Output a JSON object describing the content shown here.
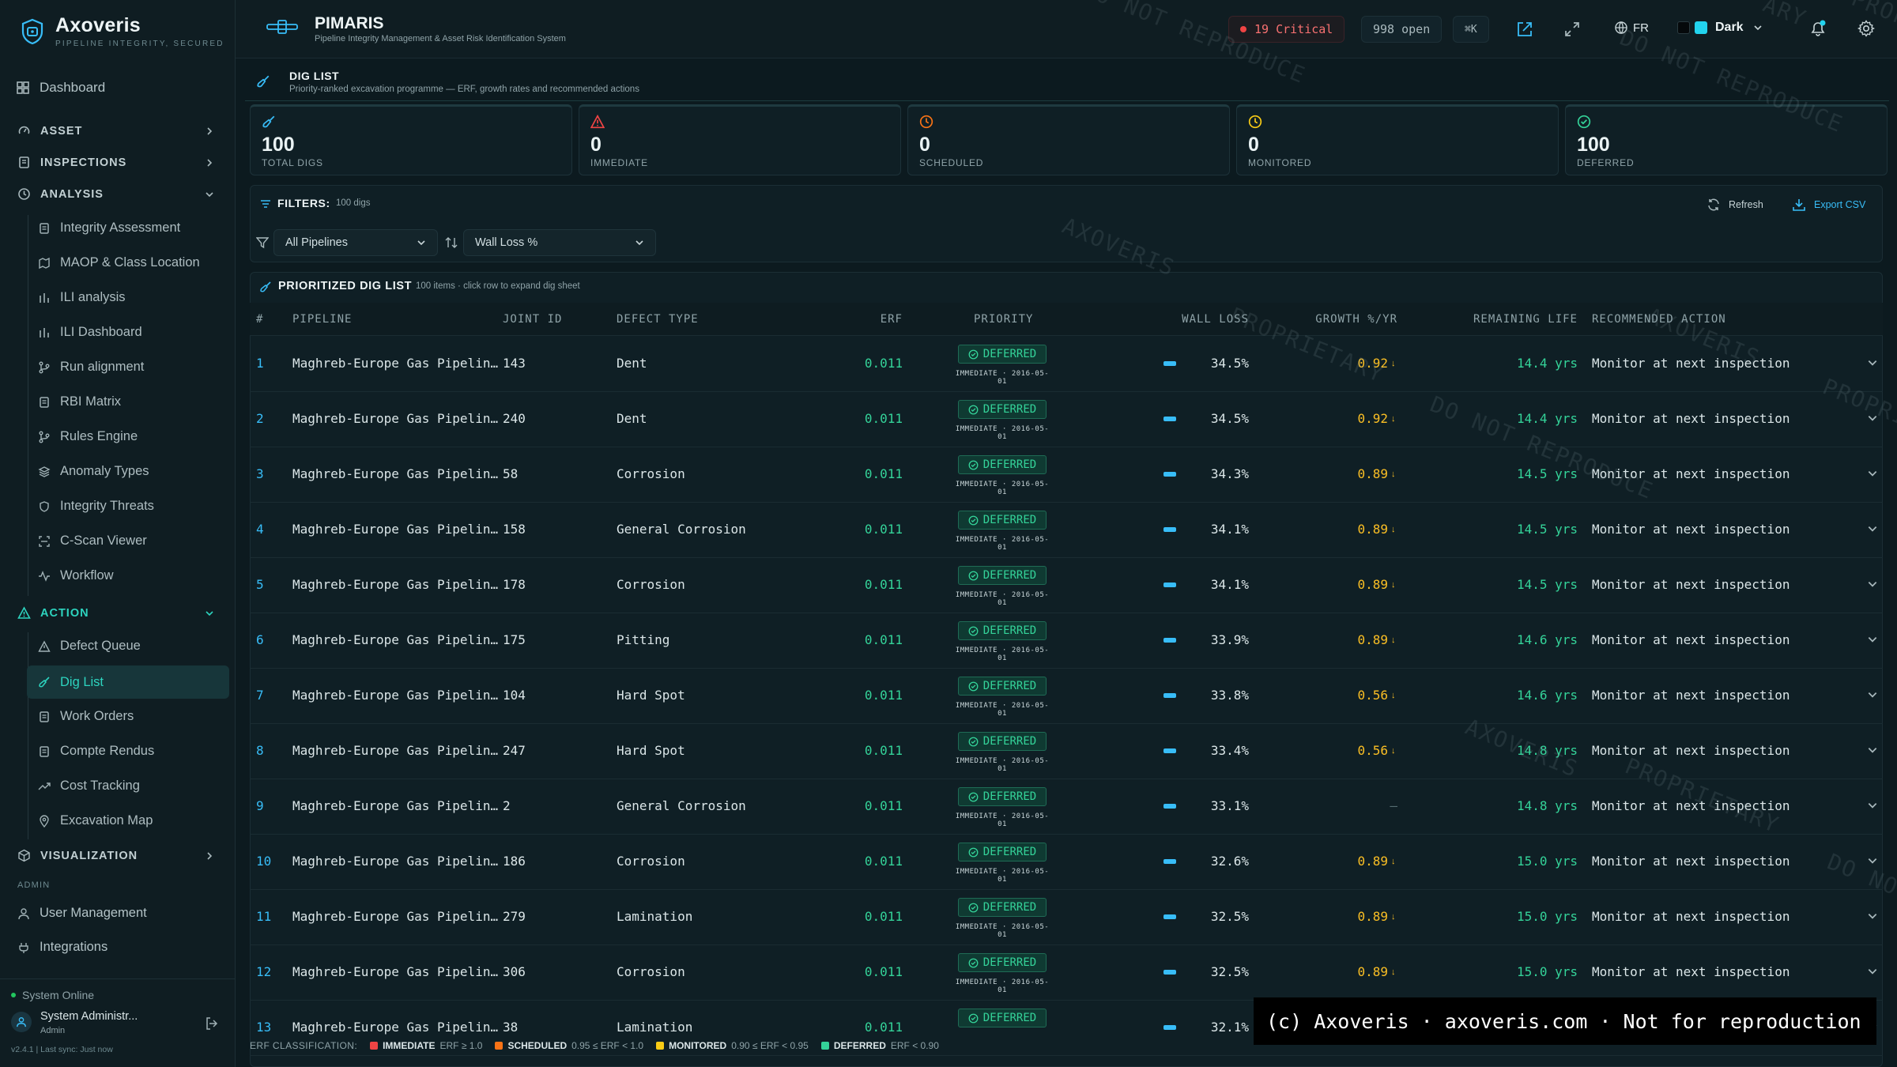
{
  "brand": {
    "name": "Axoveris",
    "tagline": "PIPELINE INTEGRITY, SECURED"
  },
  "sidebar": {
    "dashboard": "Dashboard",
    "sections": {
      "asset": "ASSET",
      "inspections": "INSPECTIONS",
      "analysis": "ANALYSIS",
      "action": "ACTION",
      "visualization": "VISUALIZATION"
    },
    "analysis_items": [
      "Integrity Assessment",
      "MAOP & Class Location",
      "ILI analysis",
      "ILI Dashboard",
      "Run alignment",
      "RBI Matrix",
      "Rules Engine",
      "Anomaly Types",
      "Integrity Threats",
      "C-Scan Viewer",
      "Workflow"
    ],
    "action_items": [
      "Defect Queue",
      "Dig List",
      "Work Orders",
      "Compte Rendus",
      "Cost Tracking",
      "Excavation Map"
    ],
    "admin_label": "ADMIN",
    "admin_items": [
      "User Management",
      "Integrations"
    ],
    "status": "System Online",
    "user_name": "System Administr...",
    "user_role": "Admin",
    "version": "v2.4.1 | Last sync: Just now"
  },
  "topbar": {
    "app_name": "PIMARIS",
    "app_subtitle": "Pipeline Integrity Management & Asset Risk Identification System",
    "critical": "19 Critical",
    "open": "998 open",
    "shortcut": "⌘K",
    "language": "FR",
    "theme": "Dark"
  },
  "page": {
    "title": "DIG LIST",
    "subtitle": "Priority-ranked excavation programme — ERF, growth rates and recommended actions"
  },
  "kpis": [
    {
      "value": "100",
      "label": "TOTAL DIGS",
      "color": "#38bdf8"
    },
    {
      "value": "0",
      "label": "IMMEDIATE",
      "color": "#ef4444"
    },
    {
      "value": "0",
      "label": "SCHEDULED",
      "color": "#f97316"
    },
    {
      "value": "0",
      "label": "MONITORED",
      "color": "#facc15"
    },
    {
      "value": "100",
      "label": "DEFERRED",
      "color": "#34d399"
    }
  ],
  "filters": {
    "label": "FILTERS:",
    "count": "100 digs",
    "refresh": "Refresh",
    "export": "Export CSV",
    "pipeline": "All Pipelines",
    "sort": "Wall Loss %"
  },
  "table": {
    "title": "PRIORITIZED DIG LIST",
    "subtitle": "100 items · click row to expand dig sheet",
    "columns": [
      "#",
      "PIPELINE",
      "JOINT ID",
      "DEFECT TYPE",
      "ERF",
      "PRIORITY",
      "WALL LOSS",
      "GROWTH %/YR",
      "REMAINING LIFE",
      "RECOMMENDED ACTION"
    ],
    "rows": [
      {
        "n": "1",
        "pipeline": "Maghreb-Europe Gas Pipelin…",
        "joint": "143",
        "defect": "Dent",
        "erf": "0.011",
        "priority": "DEFERRED",
        "sub": "IMMEDIATE · 2016-05-01",
        "wall": "34.5%",
        "growth": "0.92",
        "life": "14.4 yrs",
        "action": "Monitor at next inspection"
      },
      {
        "n": "2",
        "pipeline": "Maghreb-Europe Gas Pipelin…",
        "joint": "240",
        "defect": "Dent",
        "erf": "0.011",
        "priority": "DEFERRED",
        "sub": "IMMEDIATE · 2016-05-01",
        "wall": "34.5%",
        "growth": "0.92",
        "life": "14.4 yrs",
        "action": "Monitor at next inspection"
      },
      {
        "n": "3",
        "pipeline": "Maghreb-Europe Gas Pipelin…",
        "joint": "58",
        "defect": "Corrosion",
        "erf": "0.011",
        "priority": "DEFERRED",
        "sub": "IMMEDIATE · 2016-05-01",
        "wall": "34.3%",
        "growth": "0.89",
        "life": "14.5 yrs",
        "action": "Monitor at next inspection"
      },
      {
        "n": "4",
        "pipeline": "Maghreb-Europe Gas Pipelin…",
        "joint": "158",
        "defect": "General Corrosion",
        "erf": "0.011",
        "priority": "DEFERRED",
        "sub": "IMMEDIATE · 2016-05-01",
        "wall": "34.1%",
        "growth": "0.89",
        "life": "14.5 yrs",
        "action": "Monitor at next inspection"
      },
      {
        "n": "5",
        "pipeline": "Maghreb-Europe Gas Pipelin…",
        "joint": "178",
        "defect": "Corrosion",
        "erf": "0.011",
        "priority": "DEFERRED",
        "sub": "IMMEDIATE · 2016-05-01",
        "wall": "34.1%",
        "growth": "0.89",
        "life": "14.5 yrs",
        "action": "Monitor at next inspection"
      },
      {
        "n": "6",
        "pipeline": "Maghreb-Europe Gas Pipelin…",
        "joint": "175",
        "defect": "Pitting",
        "erf": "0.011",
        "priority": "DEFERRED",
        "sub": "IMMEDIATE · 2016-05-01",
        "wall": "33.9%",
        "growth": "0.89",
        "life": "14.6 yrs",
        "action": "Monitor at next inspection"
      },
      {
        "n": "7",
        "pipeline": "Maghreb-Europe Gas Pipelin…",
        "joint": "104",
        "defect": "Hard Spot",
        "erf": "0.011",
        "priority": "DEFERRED",
        "sub": "IMMEDIATE · 2016-05-01",
        "wall": "33.8%",
        "growth": "0.56",
        "life": "14.6 yrs",
        "action": "Monitor at next inspection"
      },
      {
        "n": "8",
        "pipeline": "Maghreb-Europe Gas Pipelin…",
        "joint": "247",
        "defect": "Hard Spot",
        "erf": "0.011",
        "priority": "DEFERRED",
        "sub": "IMMEDIATE · 2016-05-01",
        "wall": "33.4%",
        "growth": "0.56",
        "life": "14.8 yrs",
        "action": "Monitor at next inspection"
      },
      {
        "n": "9",
        "pipeline": "Maghreb-Europe Gas Pipelin…",
        "joint": "2",
        "defect": "General Corrosion",
        "erf": "0.011",
        "priority": "DEFERRED",
        "sub": "IMMEDIATE · 2016-05-01",
        "wall": "33.1%",
        "growth": "—",
        "life": "14.8 yrs",
        "action": "Monitor at next inspection"
      },
      {
        "n": "10",
        "pipeline": "Maghreb-Europe Gas Pipelin…",
        "joint": "186",
        "defect": "Corrosion",
        "erf": "0.011",
        "priority": "DEFERRED",
        "sub": "IMMEDIATE · 2016-05-01",
        "wall": "32.6%",
        "growth": "0.89",
        "life": "15.0 yrs",
        "action": "Monitor at next inspection"
      },
      {
        "n": "11",
        "pipeline": "Maghreb-Europe Gas Pipelin…",
        "joint": "279",
        "defect": "Lamination",
        "erf": "0.011",
        "priority": "DEFERRED",
        "sub": "IMMEDIATE · 2016-05-01",
        "wall": "32.5%",
        "growth": "0.89",
        "life": "15.0 yrs",
        "action": "Monitor at next inspection"
      },
      {
        "n": "12",
        "pipeline": "Maghreb-Europe Gas Pipelin…",
        "joint": "306",
        "defect": "Corrosion",
        "erf": "0.011",
        "priority": "DEFERRED",
        "sub": "IMMEDIATE · 2016-05-01",
        "wall": "32.5%",
        "growth": "0.89",
        "life": "15.0 yrs",
        "action": "Monitor at next inspection"
      },
      {
        "n": "13",
        "pipeline": "Maghreb-Europe Gas Pipelin…",
        "joint": "38",
        "defect": "Lamination",
        "erf": "0.011",
        "priority": "DEFERRED",
        "sub": "",
        "wall": "32.1%",
        "growth": "",
        "life": "",
        "action": ""
      }
    ]
  },
  "legend": {
    "label": "ERF CLASSIFICATION:",
    "items": [
      {
        "name": "IMMEDIATE",
        "range": "ERF ≥ 1.0",
        "color": "#ef4444"
      },
      {
        "name": "SCHEDULED",
        "range": "0.95 ≤ ERF < 1.0",
        "color": "#f97316"
      },
      {
        "name": "MONITORED",
        "range": "0.90 ≤ ERF < 0.95",
        "color": "#facc15"
      },
      {
        "name": "DEFERRED",
        "range": "ERF < 0.90",
        "color": "#34d399"
      }
    ]
  },
  "watermarks": [
    "DO NOT REPRODUCE",
    "DO NOT REPRODUCE",
    "AXOVERIS",
    "PROPRIETARY",
    "DO NOT REPRODUCE",
    "AXOVERIS",
    "PROPRIETARY",
    "AXOVERIS",
    "PROPRIETARY",
    "DO NO",
    "PROPRI",
    "ARY"
  ],
  "copyright": "(c) Axoveris  ·  axoveris.com  ·  Not for reproduction"
}
